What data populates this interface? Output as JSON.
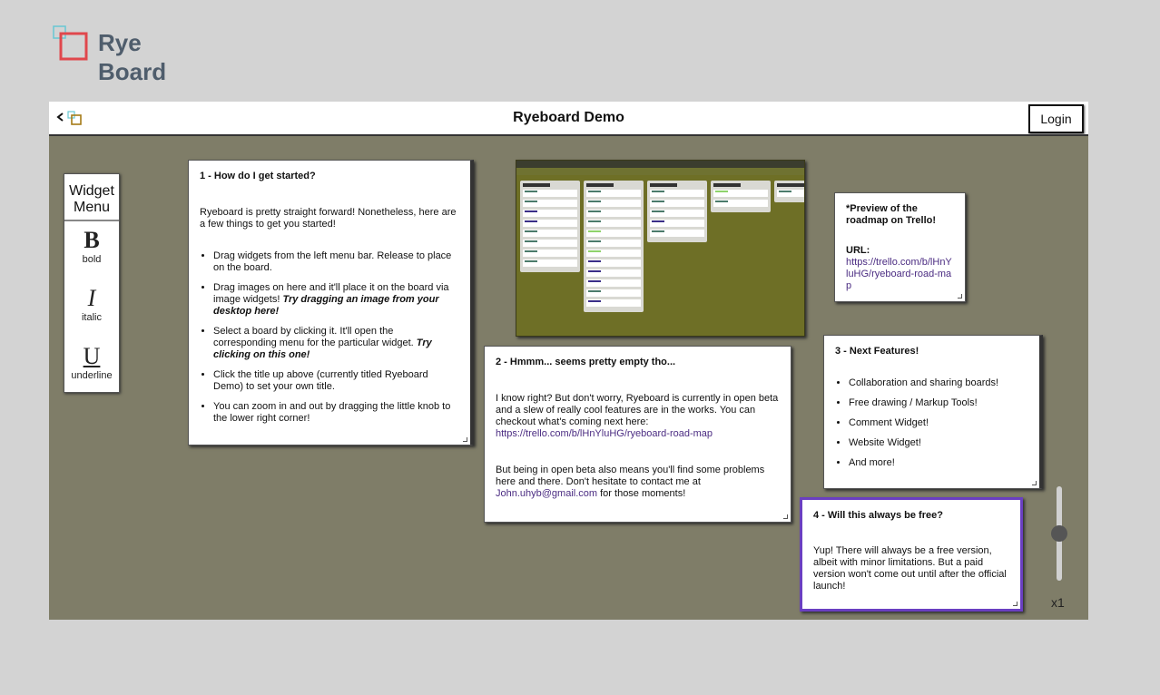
{
  "logo": {
    "line1": "Rye",
    "line2": "Board"
  },
  "header": {
    "title": "Ryeboard Demo",
    "login_label": "Login"
  },
  "widget_menu": {
    "title_line1": "Widget",
    "title_line2": "Menu",
    "items": [
      {
        "glyph": "B",
        "label": "bold"
      },
      {
        "glyph": "I",
        "label": "italic"
      },
      {
        "glyph": "U",
        "label": "underline"
      }
    ]
  },
  "cards": {
    "started": {
      "title": "1 - How do I get started?",
      "intro": "Ryeboard is pretty straight forward! Nonetheless, here are a few things to get you started!",
      "b1": "Drag widgets from the left menu bar. Release to place on the board.",
      "b2_text": "Drag images on here and it'll place it on the board via image widgets!",
      "b2_em": "Try dragging an image from your desktop here!",
      "b3_text": "Select a board by clicking it. It'll open the corresponding menu for the particular widget.",
      "b3_em": "Try clicking on this one!",
      "b4": "Click the title up above (currently titled Ryeboard Demo) to set your own title.",
      "b5": "You can zoom in and out by dragging the little knob to the lower right corner!"
    },
    "empty": {
      "title": "2 - Hmmm... seems pretty empty tho...",
      "p1": "I know right? But don't worry, Ryeboard is currently in open beta and a slew of really cool features are in the works. You can checkout what's coming next here:",
      "link": "https://trello.com/b/lHnYluHG/ryeboard-road-map",
      "p2_text": "But being in open beta also means you'll find some problems here and there. Don't hesitate to contact me at",
      "email": "John.uhyb@gmail.com",
      "p2_end": "for those moments!"
    },
    "preview_note": {
      "title": "*Preview of the roadmap on Trello!",
      "url_label": "URL:",
      "url": "https://trello.com/b/lHnYluHG/ryeboard-road-map"
    },
    "next": {
      "title": "3 - Next Features!",
      "items": [
        "Collaboration and sharing boards!",
        "Free drawing / Markup Tools!",
        "Comment Widget!",
        "Website Widget!",
        "And more!"
      ]
    },
    "free": {
      "title": "4 - Will this always be free?",
      "body": "Yup! There will always be a free version, albeit with minor limitations. But a paid version won't come out until after the official launch!"
    }
  },
  "zoom": {
    "label": "x1",
    "level": 1
  },
  "colors": {
    "board_bg": "#7f7d68",
    "page_bg": "#d3d3d3",
    "link": "#4b2c82",
    "selected_border": "#6a3fc1",
    "logo_red": "#e0474c",
    "logo_teal": "#67c8d3"
  }
}
